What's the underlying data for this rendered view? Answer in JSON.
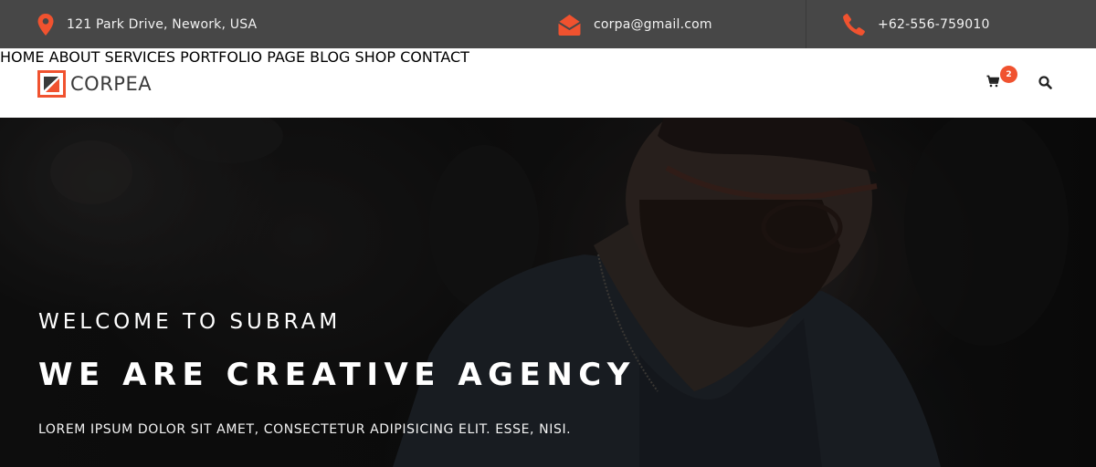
{
  "topbar": {
    "address": {
      "icon": "map-pin-icon",
      "text": "121 Park Drive, Nework, USA"
    },
    "email": {
      "icon": "envelope-icon",
      "text": "corpa@gmail.com"
    },
    "phone": {
      "icon": "phone-icon",
      "text": "+62-556-759010"
    }
  },
  "brand": {
    "name": "CORPEA",
    "icon": "corpea-logo-mark"
  },
  "nav": {
    "items": [
      "HOME",
      "ABOUT",
      "SERVICES",
      "PORTFOLIO",
      "PAGE",
      "BLOG",
      "SHOP",
      "CONTACT"
    ],
    "cart_icon": "shopping-cart-icon",
    "cart_count": "2",
    "search_icon": "search-icon"
  },
  "hero": {
    "subtitle": "WELCOME TO SUBRAM",
    "title": "WE ARE CREATIVE AGENCY",
    "text": "LOREM IPSUM DOLOR SIT AMET, CONSECTETUR ADIPISICING ELIT. ESSE, NISI."
  },
  "colors": {
    "accent": "#f0522f",
    "topbar_bg": "#474747",
    "nav_bg": "#ffffff",
    "hero_overlay": "#111111"
  }
}
